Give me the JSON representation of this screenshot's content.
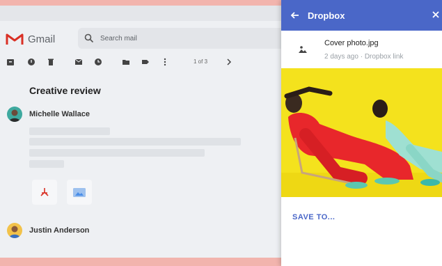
{
  "gmail": {
    "app_name": "Gmail",
    "search_placeholder": "Search mail",
    "pager": "1 of 3",
    "subject": "Creative review",
    "messages": [
      {
        "sender": "Michelle Wallace"
      },
      {
        "sender": "Justin Anderson"
      }
    ],
    "toolbar_icons": [
      "archive-icon",
      "report-icon",
      "delete-icon",
      "mark-unread-icon",
      "snooze-icon",
      "move-to-icon",
      "label-icon",
      "more-icon"
    ],
    "attachments": [
      {
        "icon": "pdf-icon",
        "color": "#d93025"
      },
      {
        "icon": "image-icon",
        "color": "#4a8ee8"
      }
    ]
  },
  "panel": {
    "title": "Dropbox",
    "accent": "#4a67c8",
    "file_name": "Cover photo.jpg",
    "file_meta": "2 days ago · Dropbox link",
    "save_label": "SAVE TO..."
  }
}
